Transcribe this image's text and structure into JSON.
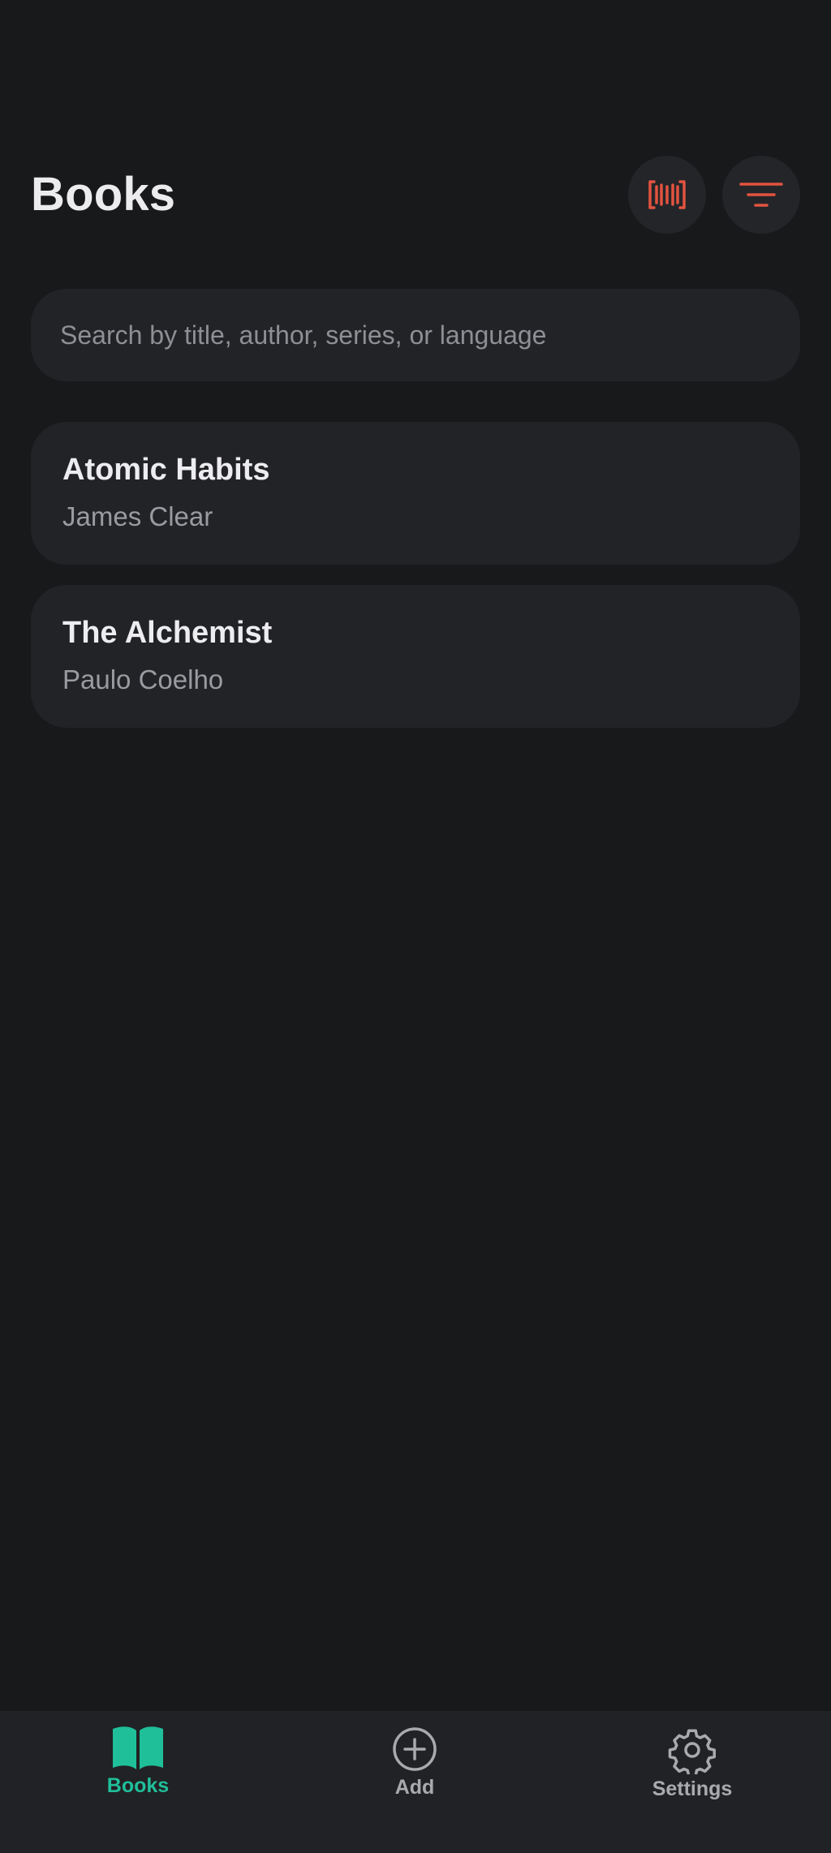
{
  "header": {
    "title": "Books",
    "scan_icon": "barcode-scan-icon",
    "filter_icon": "filter-icon"
  },
  "search": {
    "placeholder": "Search by title, author, series, or language",
    "value": ""
  },
  "books": [
    {
      "title": "Atomic Habits",
      "author": "James Clear"
    },
    {
      "title": "The Alchemist",
      "author": "Paulo Coelho"
    }
  ],
  "nav": {
    "items": [
      {
        "label": "Books",
        "icon": "open-book-icon",
        "active": true
      },
      {
        "label": "Add",
        "icon": "add-circle-icon",
        "active": false
      },
      {
        "label": "Settings",
        "icon": "gear-icon",
        "active": false
      }
    ]
  },
  "colors": {
    "background": "#18191b",
    "surface": "#222326",
    "accent_red": "#e2533f",
    "accent_teal": "#1fbf9a",
    "text_primary": "#ededf0",
    "text_secondary": "#9a9ba0"
  }
}
